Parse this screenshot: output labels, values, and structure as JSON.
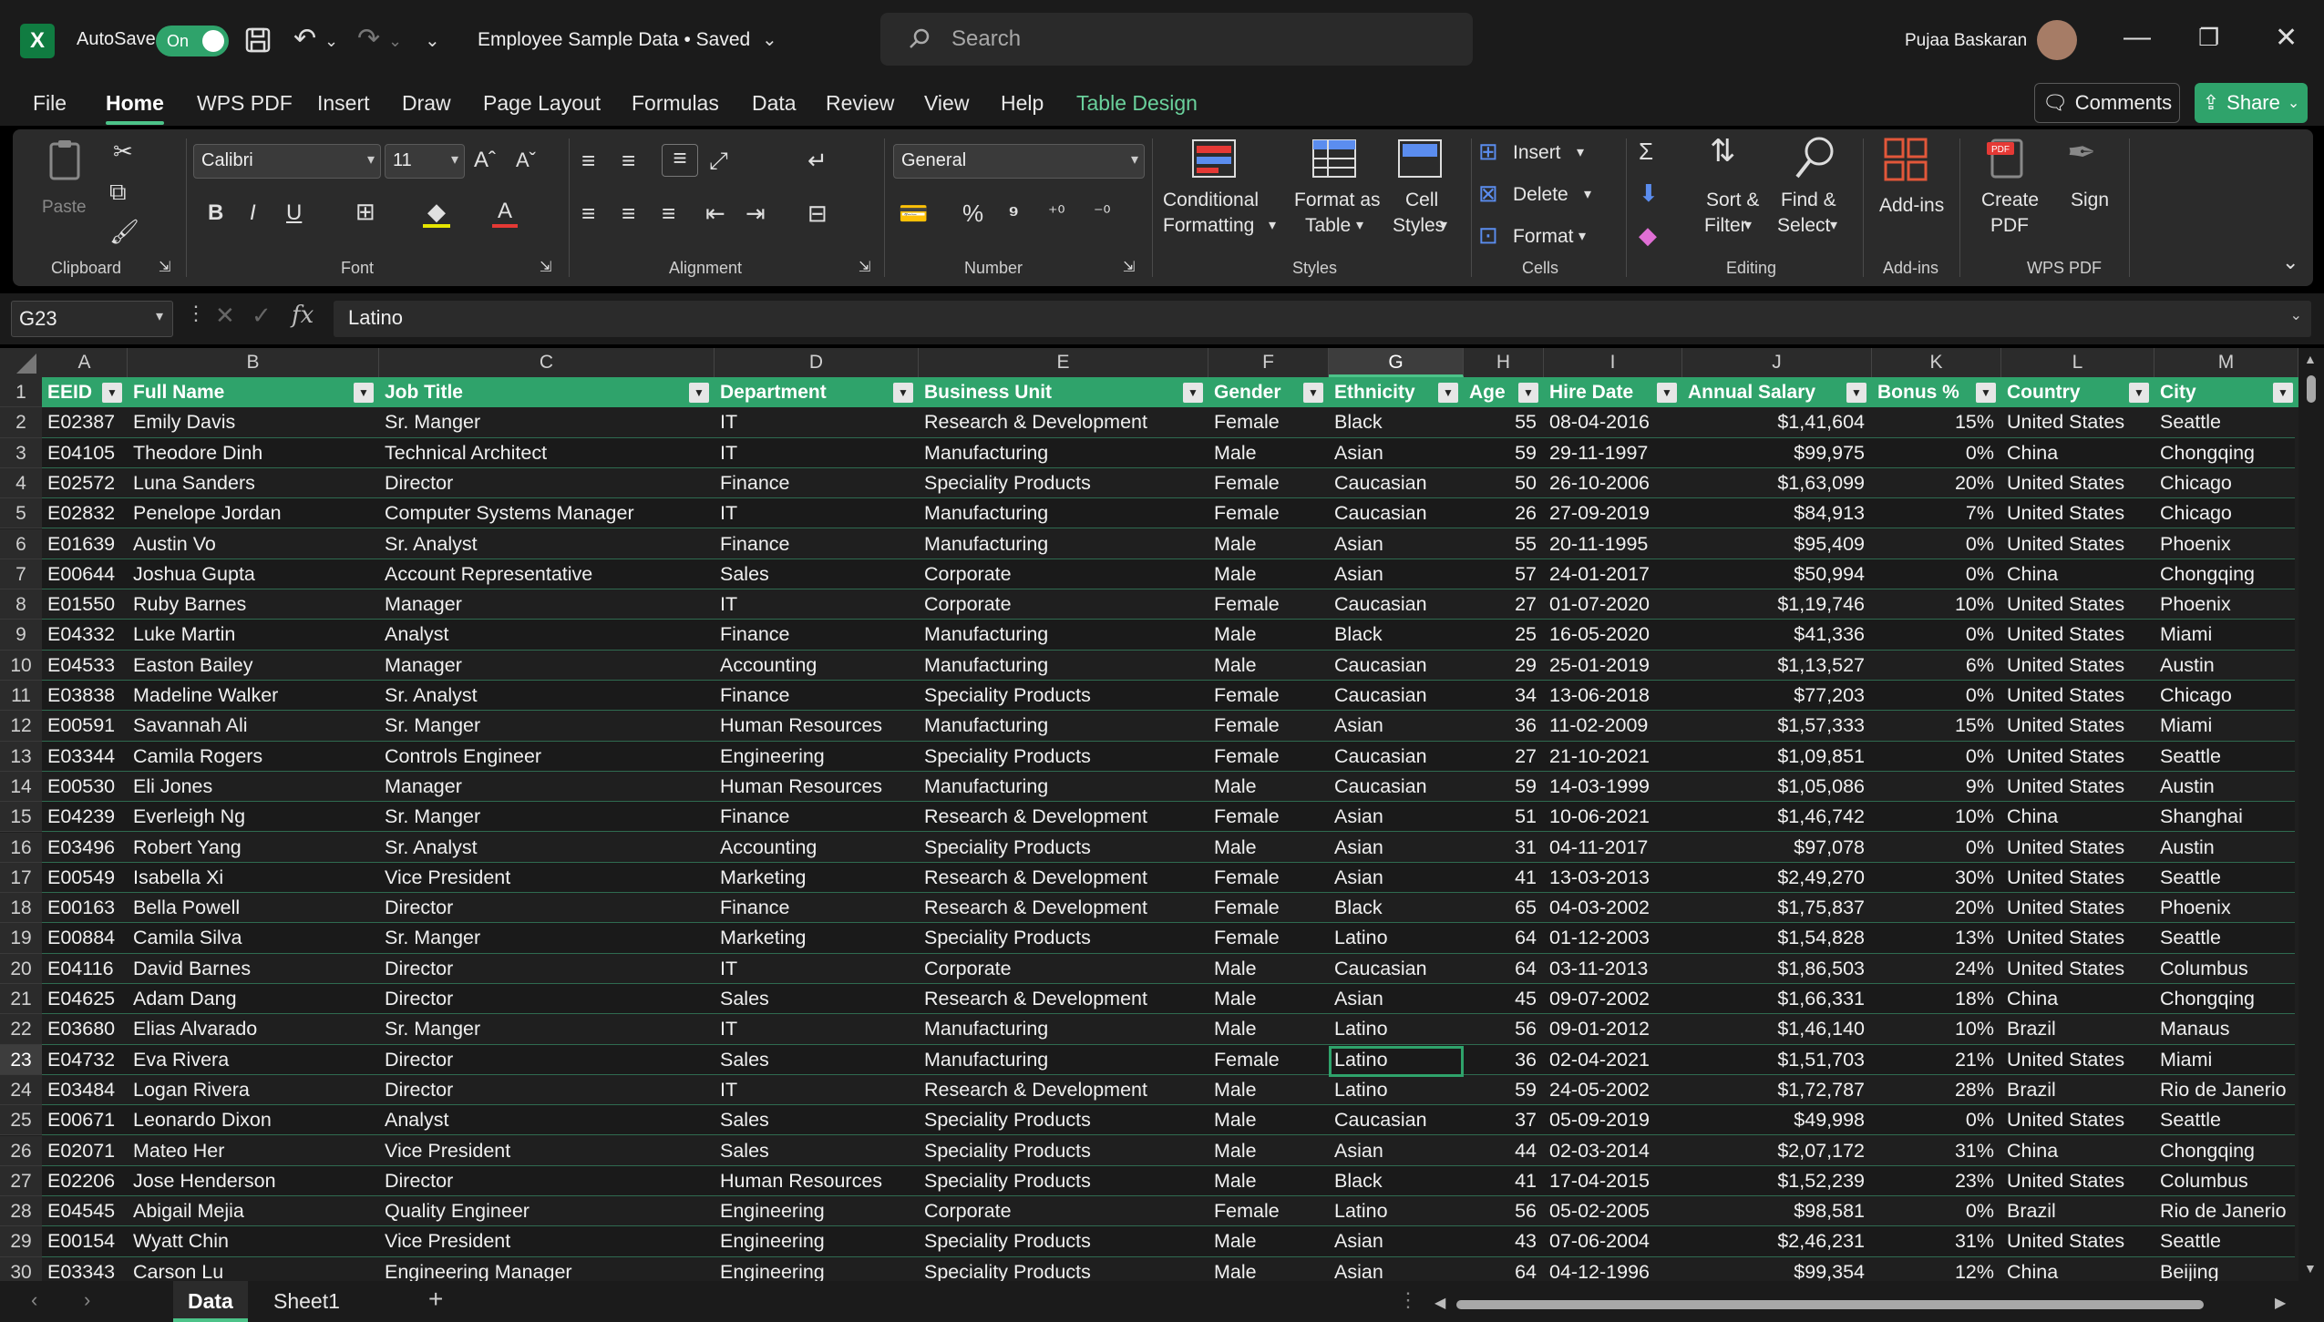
{
  "titlebar": {
    "autosave_label": "AutoSave",
    "autosave_state": "On",
    "doc_title": "Employee Sample Data • Saved",
    "search_placeholder": "Search",
    "user_name": "Pujaa Baskaran"
  },
  "menu": [
    "File",
    "Home",
    "WPS PDF",
    "Insert",
    "Draw",
    "Page Layout",
    "Formulas",
    "Data",
    "Review",
    "View",
    "Help",
    "Table Design"
  ],
  "active_menu": "Home",
  "buttons": {
    "comments": "Comments",
    "share": "Share"
  },
  "ribbon": {
    "paste": "Paste",
    "font_name": "Calibri",
    "font_size": "11",
    "number_format": "General",
    "conditional_formatting": [
      "Conditional",
      "Formatting"
    ],
    "format_as_table": [
      "Format as",
      "Table"
    ],
    "cell_styles": [
      "Cell",
      "Styles"
    ],
    "insert": "Insert",
    "delete": "Delete",
    "format": "Format",
    "sort_filter": [
      "Sort &",
      "Filter"
    ],
    "find_select": [
      "Find &",
      "Select"
    ],
    "add_ins": "Add-ins",
    "create_pdf": [
      "Create",
      "PDF"
    ],
    "sign": "Sign",
    "groups": [
      "Clipboard",
      "Font",
      "Alignment",
      "Number",
      "Styles",
      "Cells",
      "Editing",
      "Add-ins",
      "WPS PDF"
    ]
  },
  "formula_bar": {
    "name_box": "G23",
    "formula": "Latino"
  },
  "columns": [
    "A",
    "B",
    "C",
    "D",
    "E",
    "F",
    "G",
    "H",
    "I",
    "J",
    "K",
    "L",
    "M"
  ],
  "selected_column": "G",
  "table_headers": [
    "EEID",
    "Full Name",
    "Job Title",
    "Department",
    "Business Unit",
    "Gender",
    "Ethnicity",
    "Age",
    "Hire Date",
    "Annual Salary",
    "Bonus %",
    "Country",
    "City"
  ],
  "rows": [
    [
      "E02387",
      "Emily Davis",
      "Sr. Manger",
      "IT",
      "Research & Development",
      "Female",
      "Black",
      "55",
      "08-04-2016",
      "$1,41,604",
      "15%",
      "United States",
      "Seattle"
    ],
    [
      "E04105",
      "Theodore Dinh",
      "Technical Architect",
      "IT",
      "Manufacturing",
      "Male",
      "Asian",
      "59",
      "29-11-1997",
      "$99,975",
      "0%",
      "China",
      "Chongqing"
    ],
    [
      "E02572",
      "Luna Sanders",
      "Director",
      "Finance",
      "Speciality Products",
      "Female",
      "Caucasian",
      "50",
      "26-10-2006",
      "$1,63,099",
      "20%",
      "United States",
      "Chicago"
    ],
    [
      "E02832",
      "Penelope Jordan",
      "Computer Systems Manager",
      "IT",
      "Manufacturing",
      "Female",
      "Caucasian",
      "26",
      "27-09-2019",
      "$84,913",
      "7%",
      "United States",
      "Chicago"
    ],
    [
      "E01639",
      "Austin Vo",
      "Sr. Analyst",
      "Finance",
      "Manufacturing",
      "Male",
      "Asian",
      "55",
      "20-11-1995",
      "$95,409",
      "0%",
      "United States",
      "Phoenix"
    ],
    [
      "E00644",
      "Joshua Gupta",
      "Account Representative",
      "Sales",
      "Corporate",
      "Male",
      "Asian",
      "57",
      "24-01-2017",
      "$50,994",
      "0%",
      "China",
      "Chongqing"
    ],
    [
      "E01550",
      "Ruby Barnes",
      "Manager",
      "IT",
      "Corporate",
      "Female",
      "Caucasian",
      "27",
      "01-07-2020",
      "$1,19,746",
      "10%",
      "United States",
      "Phoenix"
    ],
    [
      "E04332",
      "Luke Martin",
      "Analyst",
      "Finance",
      "Manufacturing",
      "Male",
      "Black",
      "25",
      "16-05-2020",
      "$41,336",
      "0%",
      "United States",
      "Miami"
    ],
    [
      "E04533",
      "Easton Bailey",
      "Manager",
      "Accounting",
      "Manufacturing",
      "Male",
      "Caucasian",
      "29",
      "25-01-2019",
      "$1,13,527",
      "6%",
      "United States",
      "Austin"
    ],
    [
      "E03838",
      "Madeline Walker",
      "Sr. Analyst",
      "Finance",
      "Speciality Products",
      "Female",
      "Caucasian",
      "34",
      "13-06-2018",
      "$77,203",
      "0%",
      "United States",
      "Chicago"
    ],
    [
      "E00591",
      "Savannah Ali",
      "Sr. Manger",
      "Human Resources",
      "Manufacturing",
      "Female",
      "Asian",
      "36",
      "11-02-2009",
      "$1,57,333",
      "15%",
      "United States",
      "Miami"
    ],
    [
      "E03344",
      "Camila Rogers",
      "Controls Engineer",
      "Engineering",
      "Speciality Products",
      "Female",
      "Caucasian",
      "27",
      "21-10-2021",
      "$1,09,851",
      "0%",
      "United States",
      "Seattle"
    ],
    [
      "E00530",
      "Eli Jones",
      "Manager",
      "Human Resources",
      "Manufacturing",
      "Male",
      "Caucasian",
      "59",
      "14-03-1999",
      "$1,05,086",
      "9%",
      "United States",
      "Austin"
    ],
    [
      "E04239",
      "Everleigh Ng",
      "Sr. Manger",
      "Finance",
      "Research & Development",
      "Female",
      "Asian",
      "51",
      "10-06-2021",
      "$1,46,742",
      "10%",
      "China",
      "Shanghai"
    ],
    [
      "E03496",
      "Robert Yang",
      "Sr. Analyst",
      "Accounting",
      "Speciality Products",
      "Male",
      "Asian",
      "31",
      "04-11-2017",
      "$97,078",
      "0%",
      "United States",
      "Austin"
    ],
    [
      "E00549",
      "Isabella Xi",
      "Vice President",
      "Marketing",
      "Research & Development",
      "Female",
      "Asian",
      "41",
      "13-03-2013",
      "$2,49,270",
      "30%",
      "United States",
      "Seattle"
    ],
    [
      "E00163",
      "Bella Powell",
      "Director",
      "Finance",
      "Research & Development",
      "Female",
      "Black",
      "65",
      "04-03-2002",
      "$1,75,837",
      "20%",
      "United States",
      "Phoenix"
    ],
    [
      "E00884",
      "Camila Silva",
      "Sr. Manger",
      "Marketing",
      "Speciality Products",
      "Female",
      "Latino",
      "64",
      "01-12-2003",
      "$1,54,828",
      "13%",
      "United States",
      "Seattle"
    ],
    [
      "E04116",
      "David Barnes",
      "Director",
      "IT",
      "Corporate",
      "Male",
      "Caucasian",
      "64",
      "03-11-2013",
      "$1,86,503",
      "24%",
      "United States",
      "Columbus"
    ],
    [
      "E04625",
      "Adam Dang",
      "Director",
      "Sales",
      "Research & Development",
      "Male",
      "Asian",
      "45",
      "09-07-2002",
      "$1,66,331",
      "18%",
      "China",
      "Chongqing"
    ],
    [
      "E03680",
      "Elias Alvarado",
      "Sr. Manger",
      "IT",
      "Manufacturing",
      "Male",
      "Latino",
      "56",
      "09-01-2012",
      "$1,46,140",
      "10%",
      "Brazil",
      "Manaus"
    ],
    [
      "E04732",
      "Eva Rivera",
      "Director",
      "Sales",
      "Manufacturing",
      "Female",
      "Latino",
      "36",
      "02-04-2021",
      "$1,51,703",
      "21%",
      "United States",
      "Miami"
    ],
    [
      "E03484",
      "Logan Rivera",
      "Director",
      "IT",
      "Research & Development",
      "Male",
      "Latino",
      "59",
      "24-05-2002",
      "$1,72,787",
      "28%",
      "Brazil",
      "Rio de Janerio"
    ],
    [
      "E00671",
      "Leonardo Dixon",
      "Analyst",
      "Sales",
      "Speciality Products",
      "Male",
      "Caucasian",
      "37",
      "05-09-2019",
      "$49,998",
      "0%",
      "United States",
      "Seattle"
    ],
    [
      "E02071",
      "Mateo Her",
      "Vice President",
      "Sales",
      "Speciality Products",
      "Male",
      "Asian",
      "44",
      "02-03-2014",
      "$2,07,172",
      "31%",
      "China",
      "Chongqing"
    ],
    [
      "E02206",
      "Jose Henderson",
      "Director",
      "Human Resources",
      "Speciality Products",
      "Male",
      "Black",
      "41",
      "17-04-2015",
      "$1,52,239",
      "23%",
      "United States",
      "Columbus"
    ],
    [
      "E04545",
      "Abigail Mejia",
      "Quality Engineer",
      "Engineering",
      "Corporate",
      "Female",
      "Latino",
      "56",
      "05-02-2005",
      "$98,581",
      "0%",
      "Brazil",
      "Rio de Janerio"
    ],
    [
      "E00154",
      "Wyatt Chin",
      "Vice President",
      "Engineering",
      "Speciality Products",
      "Male",
      "Asian",
      "43",
      "07-06-2004",
      "$2,46,231",
      "31%",
      "United States",
      "Seattle"
    ],
    [
      "E03343",
      "Carson Lu",
      "Engineering Manager",
      "Engineering",
      "Speciality Products",
      "Male",
      "Asian",
      "64",
      "04-12-1996",
      "$99,354",
      "12%",
      "China",
      "Beijing"
    ]
  ],
  "row_numbers": [
    "1",
    "2",
    "3",
    "4",
    "5",
    "6",
    "7",
    "8",
    "9",
    "10",
    "11",
    "12",
    "13",
    "14",
    "15",
    "16",
    "17",
    "18",
    "19",
    "20",
    "21",
    "22",
    "23",
    "24",
    "25",
    "26",
    "27",
    "28",
    "29",
    "30"
  ],
  "sheets": [
    "Data",
    "Sheet1"
  ],
  "active_sheet": "Data",
  "colors": {
    "accent": "#2fa36b",
    "table_header": "#2fa36b",
    "background": "#1f1f1f"
  }
}
